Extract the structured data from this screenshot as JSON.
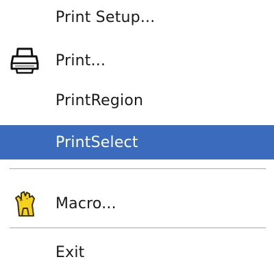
{
  "menu": {
    "items": [
      {
        "label": "Print Setup..."
      },
      {
        "label": "Print...",
        "icon": "printer-icon"
      },
      {
        "label": "PrintRegion"
      },
      {
        "label": "PrintSelect",
        "selected": true
      },
      {
        "label": "Macro...",
        "icon": "macro-hand-icon"
      },
      {
        "label": "Exit"
      }
    ]
  },
  "colors": {
    "selected_background": "#3a6bbd",
    "selected_text": "#ffffff",
    "text": "#1a1a1a",
    "separator": "#a9a9a9"
  }
}
